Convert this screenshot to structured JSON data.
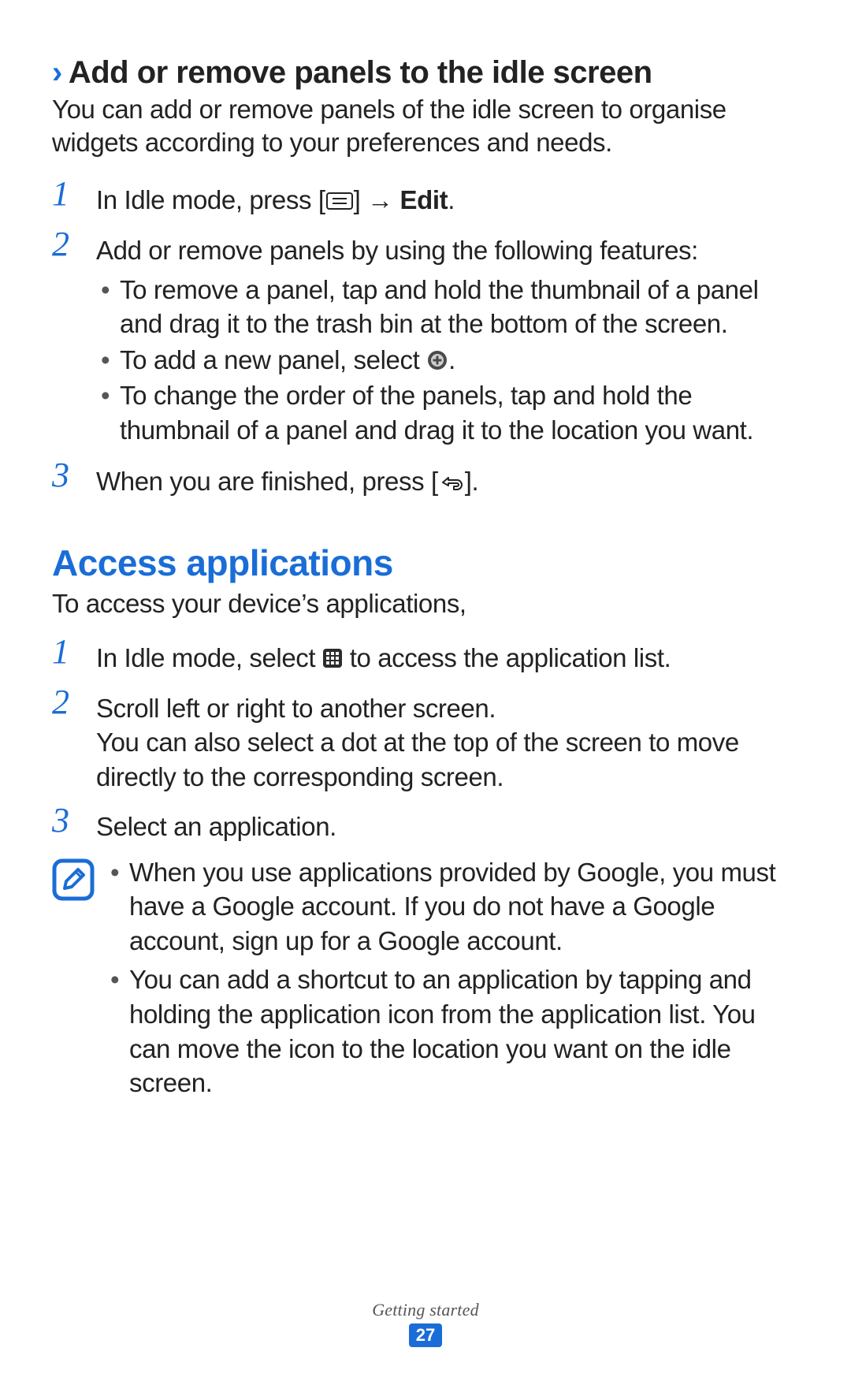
{
  "section1": {
    "heading": "Add or remove panels to the idle screen",
    "intro": "You can add or remove panels of the idle screen to organise widgets according to your preferences and needs.",
    "steps": [
      {
        "no": "1",
        "pre": "In Idle mode, press [",
        "arrow": "] → ",
        "bold": "Edit",
        "post": "."
      },
      {
        "no": "2",
        "text": "Add or remove panels by using the following features:",
        "bullets": [
          "To remove a panel, tap and hold the thumbnail of a panel and drag it to the trash bin at the bottom of the screen.",
          {
            "pre": "To add a new panel, select ",
            "iconAfter": "plus",
            "post": "."
          },
          "To change the order of the panels, tap and hold the thumbnail of a panel and drag it to the location you want."
        ]
      },
      {
        "no": "3",
        "pre": "When you are finished, press [",
        "post": "]."
      }
    ]
  },
  "section2": {
    "heading": "Access applications",
    "intro": "To access your device’s applications,",
    "steps": [
      {
        "no": "1",
        "pre": "In Idle mode, select ",
        "post": " to access the application list."
      },
      {
        "no": "2",
        "line1": "Scroll left or right to another screen.",
        "line2": "You can also select a dot at the top of the screen to move directly to the corresponding screen."
      },
      {
        "no": "3",
        "text": "Select an application."
      }
    ],
    "note": [
      "When you use applications provided by Google, you must have a Google account. If you do not have a Google account, sign up for a Google account.",
      "You can add a shortcut to an application by tapping and holding the application icon from the application list. You can move the icon to the location you want on the idle screen."
    ]
  },
  "footer": {
    "label": "Getting started",
    "page": "27"
  }
}
